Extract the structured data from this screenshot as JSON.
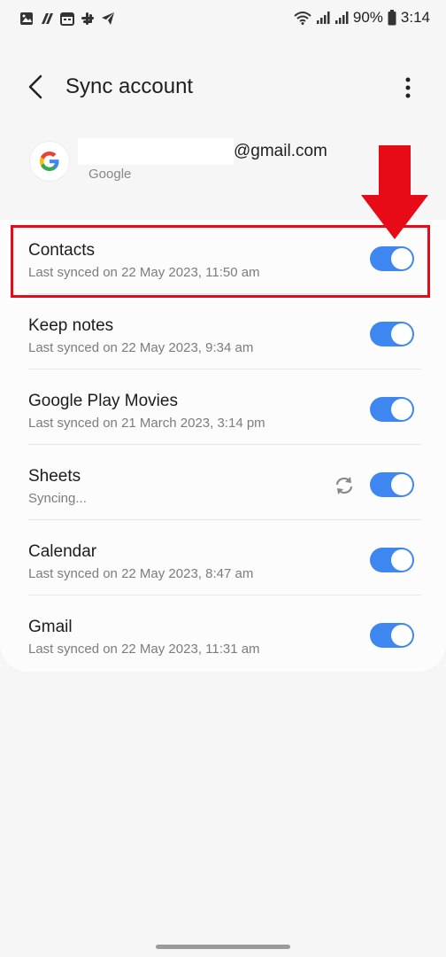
{
  "status_bar": {
    "battery": "90%",
    "time": "3:14",
    "icons": [
      "gallery-icon",
      "app-icon",
      "calendar-icon",
      "slack-icon",
      "telegram-icon"
    ]
  },
  "header": {
    "title": "Sync account"
  },
  "account": {
    "email_suffix": "@gmail.com",
    "provider": "Google"
  },
  "sync_items": [
    {
      "name": "Contacts",
      "status": "Last synced on 22 May 2023, 11:50 am",
      "enabled": true
    },
    {
      "name": "Keep notes",
      "status": "Last synced on 22 May 2023, 9:34 am",
      "enabled": true
    },
    {
      "name": "Google Play Movies",
      "status": "Last synced on 21 March 2023, 3:14 pm",
      "enabled": true
    },
    {
      "name": "Sheets",
      "status": "Syncing...",
      "enabled": true,
      "syncing": true
    },
    {
      "name": "Calendar",
      "status": "Last synced on 22 May 2023, 8:47 am",
      "enabled": true
    },
    {
      "name": "Gmail",
      "status": "Last synced on 22 May 2023, 11:31 am",
      "enabled": true
    }
  ],
  "colors": {
    "toggle_on": "#3e86f0",
    "annotation_red": "#e60b16"
  }
}
